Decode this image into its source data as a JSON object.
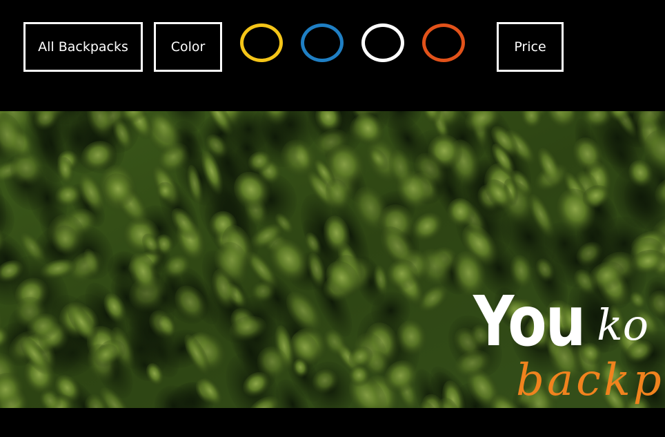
{
  "filters": {
    "all_label": "All Backpacks",
    "color_label": "Color",
    "price_label": "Price",
    "colors": [
      {
        "name": "yellow",
        "hex": "#f5c518"
      },
      {
        "name": "blue",
        "hex": "#1f7fc4"
      },
      {
        "name": "white",
        "hex": "#ffffff"
      },
      {
        "name": "orange",
        "hex": "#e2521a"
      }
    ]
  },
  "hero": {
    "line1_bold": "You",
    "line1_script": "ko",
    "line2_script": "backp",
    "line2_color": "#f0831e",
    "background_image": "aerial-forest-canopy"
  }
}
